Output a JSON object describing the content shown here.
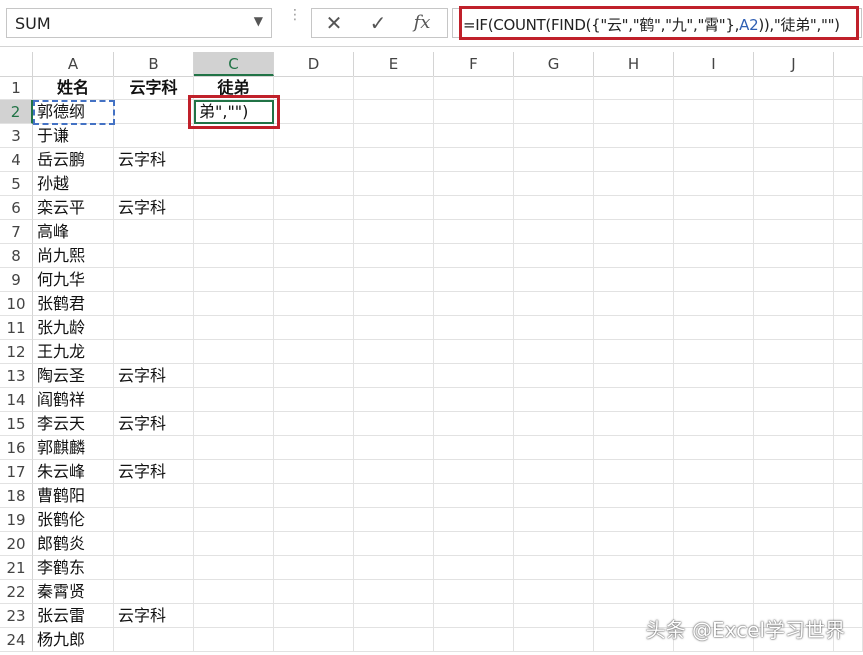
{
  "name_box": {
    "value": "SUM",
    "dropdown_icon": "chevron-down-icon"
  },
  "formula_bar": {
    "cancel_icon": "close-icon",
    "enter_icon": "check-icon",
    "fx_label": "fx",
    "formula_part1": "=IF(COUNT(FIND({\"云\",\"鹤\",\"九\",\"霄\"},",
    "formula_ref": "A2",
    "formula_part2": ")),\"徒弟\",\"\")"
  },
  "columns": [
    "A",
    "B",
    "C",
    "D",
    "E",
    "F",
    "G",
    "H",
    "I",
    "J"
  ],
  "selected_column": "C",
  "rows": [
    {
      "num": "1",
      "a": "姓名",
      "b": "云字科",
      "c": "徒弟"
    },
    {
      "num": "2",
      "a": "郭德纲",
      "b": "",
      "c": "弟\",\"\")"
    },
    {
      "num": "3",
      "a": "于谦",
      "b": "",
      "c": ""
    },
    {
      "num": "4",
      "a": "岳云鹏",
      "b": "云字科",
      "c": ""
    },
    {
      "num": "5",
      "a": "孙越",
      "b": "",
      "c": ""
    },
    {
      "num": "6",
      "a": "栾云平",
      "b": "云字科",
      "c": ""
    },
    {
      "num": "7",
      "a": "高峰",
      "b": "",
      "c": ""
    },
    {
      "num": "8",
      "a": "尚九熙",
      "b": "",
      "c": ""
    },
    {
      "num": "9",
      "a": "何九华",
      "b": "",
      "c": ""
    },
    {
      "num": "10",
      "a": "张鹤君",
      "b": "",
      "c": ""
    },
    {
      "num": "11",
      "a": "张九龄",
      "b": "",
      "c": ""
    },
    {
      "num": "12",
      "a": "王九龙",
      "b": "",
      "c": ""
    },
    {
      "num": "13",
      "a": "陶云圣",
      "b": "云字科",
      "c": ""
    },
    {
      "num": "14",
      "a": "阎鹤祥",
      "b": "",
      "c": ""
    },
    {
      "num": "15",
      "a": "李云天",
      "b": "云字科",
      "c": ""
    },
    {
      "num": "16",
      "a": "郭麒麟",
      "b": "",
      "c": ""
    },
    {
      "num": "17",
      "a": "朱云峰",
      "b": "云字科",
      "c": ""
    },
    {
      "num": "18",
      "a": "曹鹤阳",
      "b": "",
      "c": ""
    },
    {
      "num": "19",
      "a": "张鹤伦",
      "b": "",
      "c": ""
    },
    {
      "num": "20",
      "a": "郎鹤炎",
      "b": "",
      "c": ""
    },
    {
      "num": "21",
      "a": "李鹤东",
      "b": "",
      "c": ""
    },
    {
      "num": "22",
      "a": "秦霄贤",
      "b": "",
      "c": ""
    },
    {
      "num": "23",
      "a": "张云雷",
      "b": "云字科",
      "c": ""
    },
    {
      "num": "24",
      "a": "杨九郎",
      "b": "",
      "c": ""
    }
  ],
  "watermark": "头条 @Excel学习世界",
  "colors": {
    "accent_green": "#217346",
    "highlight_red": "#c0202a",
    "ref_blue": "#2f5fb3"
  }
}
